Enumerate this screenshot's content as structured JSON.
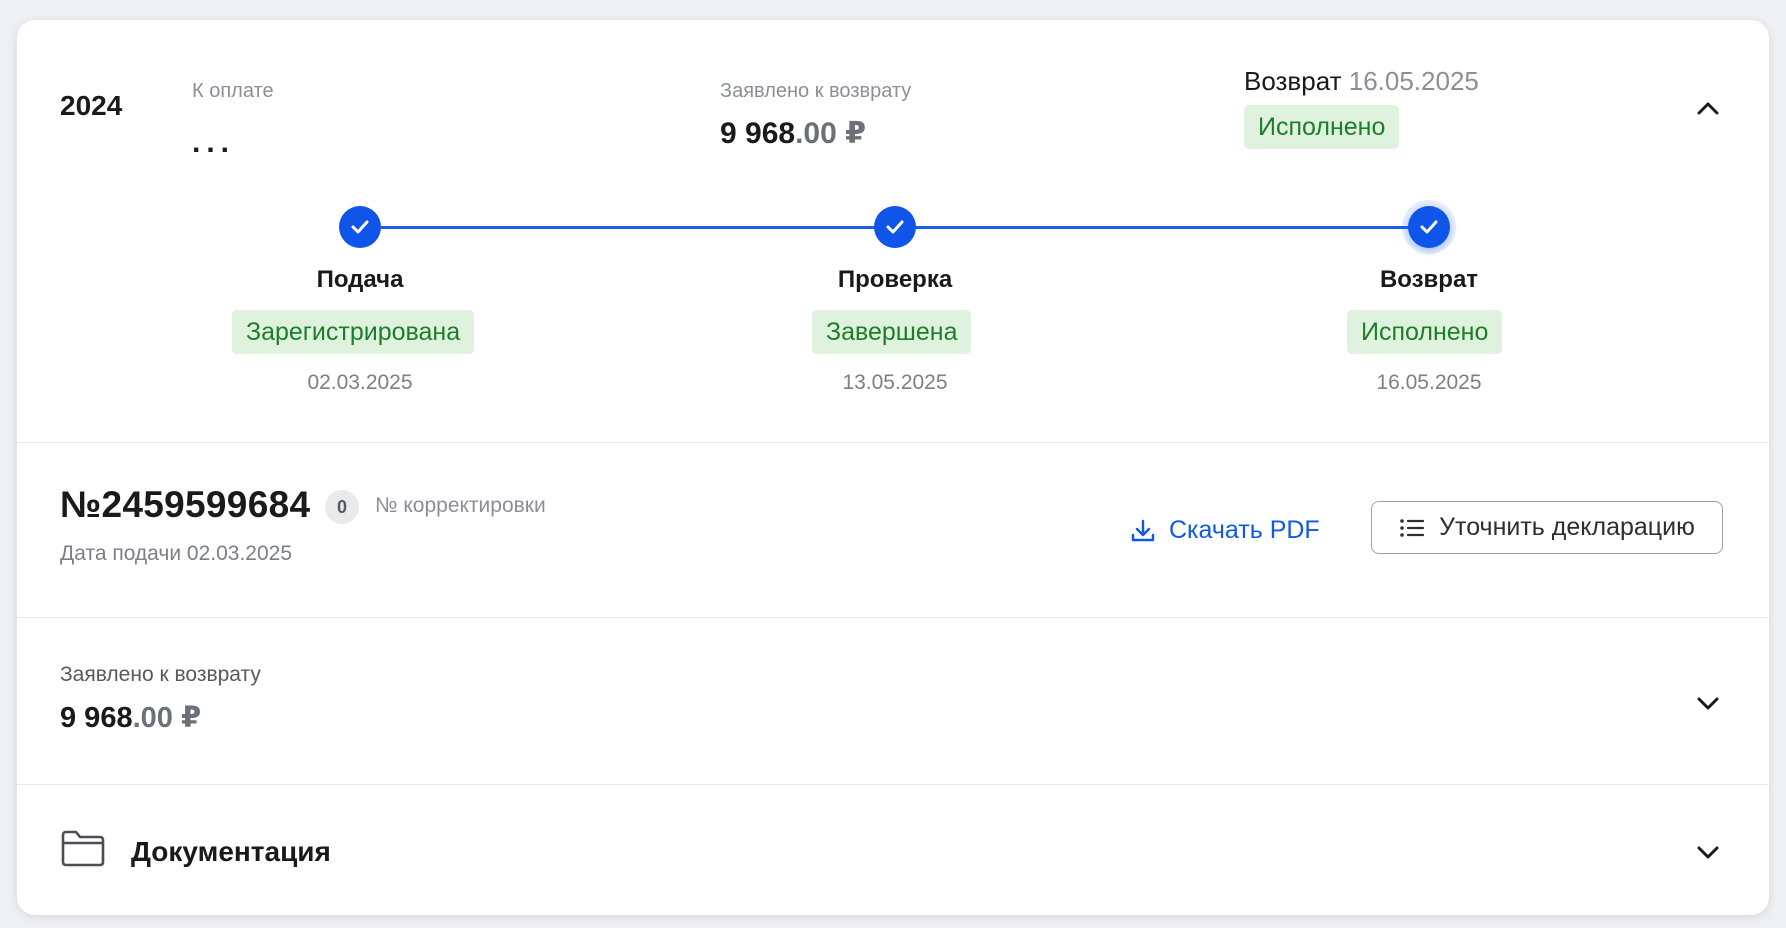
{
  "summary": {
    "year": "2024",
    "to_pay_label": "К оплате",
    "to_pay_value": "...",
    "claimed_label": "Заявлено к возврату",
    "claimed_int": "9 968",
    "claimed_dec": ".00 ₽",
    "refund_label": "Возврат",
    "refund_date": "16.05.2025",
    "refund_status": "Исполнено"
  },
  "timeline": {
    "steps": [
      {
        "name": "Подача",
        "status": "Зарегистрирована",
        "date": "02.03.2025"
      },
      {
        "name": "Проверка",
        "status": "Завершена",
        "date": "13.05.2025"
      },
      {
        "name": "Возврат",
        "status": "Исполнено",
        "date": "16.05.2025"
      }
    ]
  },
  "declaration": {
    "number": "№2459599684",
    "correction_count": "0",
    "correction_label": "№ корректировки",
    "submit_date": "Дата подачи 02.03.2025",
    "download_label": "Скачать PDF",
    "refine_label": "Уточнить декларацию"
  },
  "claimed_section": {
    "label": "Заявлено к возврату",
    "amount_int": "9 968",
    "amount_dec": ".00 ₽"
  },
  "docs_section": {
    "title": "Документация"
  },
  "colors": {
    "accent": "#0f55ea",
    "status_bg": "#dff2dd",
    "status_text": "#1e7d2a"
  }
}
